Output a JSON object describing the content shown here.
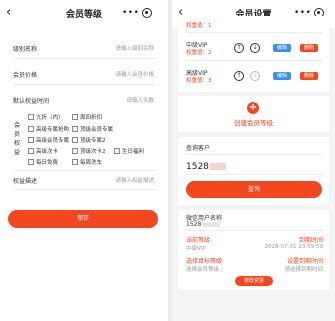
{
  "left": {
    "nav": {
      "back": "‹",
      "title": "会员等级",
      "more": "•••"
    },
    "form": {
      "level_name_label": "级别名称",
      "level_name_placeholder": "请输入级别名称",
      "price_label": "会员价格",
      "price_placeholder": "请输入会员价格",
      "days_label": "默认权益时间",
      "days_placeholder": "请输入天数",
      "benefits_label": "会员权益",
      "benefits": [
        [
          "九折（内）",
          "周四折扣"
        ],
        [
          "高级专属抢购",
          "顶级会员专属"
        ],
        [
          "高级会员专属",
          "顶级专属2"
        ],
        [
          "高级次卡",
          "顶级次卡2",
          "生日福利"
        ],
        [
          "每日免费",
          "每周洗车"
        ]
      ],
      "desc_label": "权益描述",
      "desc_placeholder": "请输入权益描述"
    },
    "save": "保存"
  },
  "right": {
    "nav": {
      "back": "‹",
      "title": "会员设置",
      "more": "•••"
    },
    "tiers": [
      {
        "name": "",
        "weight": "权重值：1"
      },
      {
        "name": "中级VIP",
        "weight": "权重值：2"
      },
      {
        "name": "高级VIP",
        "weight": "权重值：3"
      }
    ],
    "edit_label": "编辑",
    "delete_label": "删除",
    "up": "↑",
    "down": "↓",
    "create_plus": "+",
    "create_label": "创建会员等级",
    "query_title": "查询客户",
    "query_value": "1528",
    "query_button": "查询",
    "result": {
      "nickname_label": "微信用户名称",
      "phone": "1528",
      "current_level_label": "当前等级",
      "expire_label": "到期时间",
      "current_level": "中级VIP",
      "expire_value": "2028-07-31 23:59:59",
      "select_level_label": "选择目标等级",
      "set_expire_label": "设置到期时间",
      "select_level_placeholder": "选择会员等级",
      "set_expire_placeholder": "请选择到期时间",
      "confirm": "修改变更"
    }
  }
}
